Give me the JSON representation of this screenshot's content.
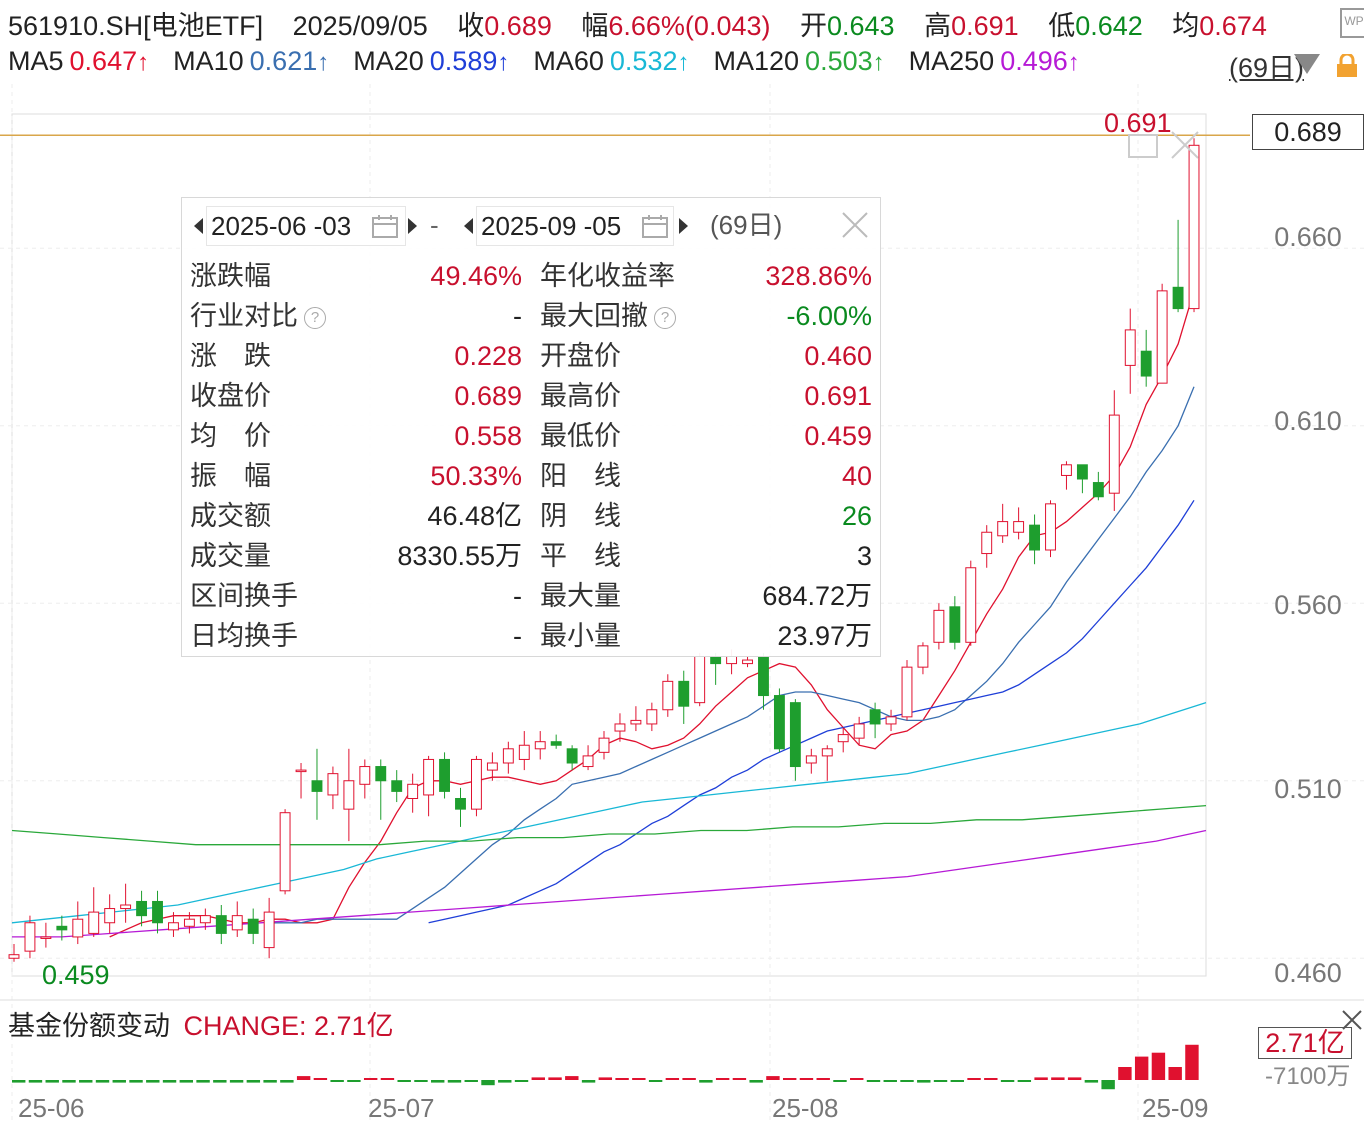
{
  "header": {
    "code": "561910.SH[电池ETF]",
    "date": "2025/09/05",
    "close_label": "收",
    "close": "0.689",
    "change_label": "幅",
    "change": "6.66%(0.043)",
    "open_label": "开",
    "open": "0.643",
    "high_label": "高",
    "high": "0.691",
    "low_label": "低",
    "low": "0.642",
    "avg_label": "均",
    "avg": "0.674"
  },
  "ma": [
    {
      "label": "MA5",
      "value": "0.647",
      "color": "#e0112f"
    },
    {
      "label": "MA10",
      "value": "0.621",
      "color": "#3a6fb0"
    },
    {
      "label": "MA20",
      "value": "0.589",
      "color": "#1f3fd8"
    },
    {
      "label": "MA60",
      "value": "0.532",
      "color": "#19b8d6"
    },
    {
      "label": "MA120",
      "value": "0.503",
      "color": "#2aa83a"
    },
    {
      "label": "MA250",
      "value": "0.496",
      "color": "#b61ad6"
    }
  ],
  "ma_arrow": "↑",
  "period_select": "(69日)",
  "y_axis": [
    "0.660",
    "0.610",
    "0.560",
    "0.510",
    "0.460"
  ],
  "current_price_tag": "0.689",
  "max_marker": "0.691",
  "min_marker": "0.459",
  "x_axis": [
    "25-06",
    "25-07",
    "25-08",
    "25-09"
  ],
  "stats_panel": {
    "start_date": "2025-06 -03",
    "separator": "-",
    "end_date": "2025-09 -05",
    "days": "(69日)",
    "rows": [
      {
        "l1": "涨跌幅",
        "v1": "49.46%",
        "c1": "red",
        "l2": "年化收益率",
        "v2": "328.86%",
        "c2": "red"
      },
      {
        "l1": "行业对比",
        "q1": true,
        "v1": "-",
        "c1": "dark",
        "l2": "最大回撤",
        "q2": true,
        "v2": "-6.00%",
        "c2": "green"
      },
      {
        "l1": "涨　跌",
        "v1": "0.228",
        "c1": "red",
        "l2": "开盘价",
        "v2": "0.460",
        "c2": "red"
      },
      {
        "l1": "收盘价",
        "v1": "0.689",
        "c1": "red",
        "l2": "最高价",
        "v2": "0.691",
        "c2": "red"
      },
      {
        "l1": "均　价",
        "v1": "0.558",
        "c1": "red",
        "l2": "最低价",
        "v2": "0.459",
        "c2": "red"
      },
      {
        "l1": "振　幅",
        "v1": "50.33%",
        "c1": "red",
        "l2": "阳　线",
        "v2": "40",
        "c2": "red"
      },
      {
        "l1": "成交额",
        "v1": "46.48亿",
        "c1": "dark",
        "l2": "阴　线",
        "v2": "26",
        "c2": "green"
      },
      {
        "l1": "成交量",
        "v1": "8330.55万",
        "c1": "dark",
        "l2": "平　线",
        "v2": "3",
        "c2": "dark"
      },
      {
        "l1": "区间换手",
        "v1": "-",
        "c1": "dark",
        "l2": "最大量",
        "v2": "684.72万",
        "c2": "dark"
      },
      {
        "l1": "日均换手",
        "v1": "-",
        "c1": "dark",
        "l2": "最小量",
        "v2": "23.97万",
        "c2": "dark"
      }
    ]
  },
  "sub_chart": {
    "title": "基金份额变动",
    "change_label": "CHANGE: 2.71亿",
    "value_tag": "2.71亿",
    "neg_tag": "-7100万"
  },
  "chart_data": {
    "type": "candlestick",
    "ylim": [
      0.455,
      0.695
    ],
    "candles": [
      [
        0.46,
        0.461,
        0.459,
        0.464
      ],
      [
        0.462,
        0.47,
        0.46,
        0.472
      ],
      [
        0.466,
        0.466,
        0.463,
        0.47
      ],
      [
        0.469,
        0.468,
        0.465,
        0.472
      ],
      [
        0.466,
        0.471,
        0.464,
        0.476
      ],
      [
        0.467,
        0.473,
        0.466,
        0.48
      ],
      [
        0.47,
        0.474,
        0.467,
        0.478
      ],
      [
        0.474,
        0.475,
        0.47,
        0.481
      ],
      [
        0.476,
        0.472,
        0.469,
        0.479
      ],
      [
        0.476,
        0.47,
        0.467,
        0.479
      ],
      [
        0.468,
        0.47,
        0.466,
        0.473
      ],
      [
        0.469,
        0.471,
        0.467,
        0.473
      ],
      [
        0.47,
        0.472,
        0.468,
        0.474
      ],
      [
        0.472,
        0.467,
        0.464,
        0.475
      ],
      [
        0.468,
        0.472,
        0.466,
        0.476
      ],
      [
        0.471,
        0.467,
        0.464,
        0.474
      ],
      [
        0.463,
        0.473,
        0.46,
        0.477
      ],
      [
        0.479,
        0.501,
        0.478,
        0.502
      ],
      [
        0.513,
        0.513,
        0.505,
        0.515
      ],
      [
        0.51,
        0.507,
        0.499,
        0.519
      ],
      [
        0.506,
        0.512,
        0.502,
        0.514
      ],
      [
        0.502,
        0.51,
        0.493,
        0.519
      ],
      [
        0.509,
        0.514,
        0.505,
        0.516
      ],
      [
        0.514,
        0.51,
        0.499,
        0.516
      ],
      [
        0.51,
        0.507,
        0.504,
        0.513
      ],
      [
        0.505,
        0.509,
        0.501,
        0.512
      ],
      [
        0.506,
        0.516,
        0.5,
        0.517
      ],
      [
        0.516,
        0.507,
        0.505,
        0.518
      ],
      [
        0.505,
        0.502,
        0.497,
        0.508
      ],
      [
        0.502,
        0.516,
        0.5,
        0.517
      ],
      [
        0.513,
        0.515,
        0.51,
        0.518
      ],
      [
        0.515,
        0.519,
        0.512,
        0.521
      ],
      [
        0.516,
        0.52,
        0.513,
        0.524
      ],
      [
        0.519,
        0.521,
        0.516,
        0.524
      ],
      [
        0.521,
        0.52,
        0.519,
        0.523
      ],
      [
        0.519,
        0.515,
        0.513,
        0.52
      ],
      [
        0.514,
        0.517,
        0.513,
        0.52
      ],
      [
        0.518,
        0.522,
        0.516,
        0.524
      ],
      [
        0.524,
        0.526,
        0.521,
        0.529
      ],
      [
        0.526,
        0.527,
        0.524,
        0.531
      ],
      [
        0.526,
        0.53,
        0.524,
        0.532
      ],
      [
        0.53,
        0.538,
        0.528,
        0.54
      ],
      [
        0.538,
        0.531,
        0.526,
        0.541
      ],
      [
        0.532,
        0.545,
        0.531,
        0.546
      ],
      [
        0.545,
        0.543,
        0.537,
        0.546
      ],
      [
        0.543,
        0.545,
        0.54,
        0.547
      ],
      [
        0.543,
        0.544,
        0.542,
        0.545
      ],
      [
        0.545,
        0.534,
        0.53,
        0.546
      ],
      [
        0.534,
        0.519,
        0.518,
        0.536
      ],
      [
        0.532,
        0.514,
        0.51,
        0.533
      ],
      [
        0.515,
        0.517,
        0.512,
        0.519
      ],
      [
        0.517,
        0.519,
        0.51,
        0.52
      ],
      [
        0.521,
        0.523,
        0.518,
        0.525
      ],
      [
        0.522,
        0.526,
        0.52,
        0.528
      ],
      [
        0.53,
        0.526,
        0.522,
        0.532
      ],
      [
        0.526,
        0.528,
        0.524,
        0.53
      ],
      [
        0.528,
        0.542,
        0.527,
        0.544
      ],
      [
        0.542,
        0.548,
        0.54,
        0.549
      ],
      [
        0.549,
        0.558,
        0.547,
        0.56
      ],
      [
        0.559,
        0.549,
        0.547,
        0.562
      ],
      [
        0.549,
        0.57,
        0.548,
        0.572
      ],
      [
        0.574,
        0.58,
        0.57,
        0.582
      ],
      [
        0.579,
        0.583,
        0.577,
        0.588
      ],
      [
        0.58,
        0.583,
        0.578,
        0.587
      ],
      [
        0.582,
        0.575,
        0.571,
        0.585
      ],
      [
        0.575,
        0.588,
        0.573,
        0.589
      ],
      [
        0.596,
        0.599,
        0.592,
        0.6
      ],
      [
        0.599,
        0.595,
        0.591,
        0.599
      ],
      [
        0.594,
        0.59,
        0.589,
        0.597
      ],
      [
        0.591,
        0.613,
        0.586,
        0.62
      ],
      [
        0.627,
        0.637,
        0.619,
        0.643
      ],
      [
        0.631,
        0.624,
        0.621,
        0.637
      ],
      [
        0.622,
        0.648,
        0.622,
        0.65
      ],
      [
        0.649,
        0.643,
        0.642,
        0.668
      ],
      [
        0.643,
        0.689,
        0.642,
        0.691
      ]
    ],
    "ma_lines": {
      "MA5": [
        0.466,
        0.468,
        0.47,
        0.471,
        0.472,
        0.472,
        0.472,
        0.471,
        0.47,
        0.47,
        0.471,
        0.471,
        0.47,
        0.47,
        0.471,
        0.48,
        0.487,
        0.493,
        0.501,
        0.508,
        0.51,
        0.51,
        0.509,
        0.51,
        0.511,
        0.511,
        0.51,
        0.509,
        0.51,
        0.513,
        0.516,
        0.52,
        0.522,
        0.521,
        0.519,
        0.52,
        0.522,
        0.526,
        0.531,
        0.535,
        0.539,
        0.541,
        0.543,
        0.542,
        0.537,
        0.53,
        0.525,
        0.52,
        0.519,
        0.523,
        0.524,
        0.527,
        0.534,
        0.541,
        0.549,
        0.557,
        0.564,
        0.573,
        0.579,
        0.58,
        0.583,
        0.587,
        0.591,
        0.596,
        0.604,
        0.616,
        0.624,
        0.633,
        0.648
      ],
      "MA10": [
        0.47,
        0.47,
        0.47,
        0.471,
        0.471,
        0.471,
        0.471,
        0.471,
        0.471,
        0.474,
        0.477,
        0.48,
        0.484,
        0.488,
        0.492,
        0.495,
        0.499,
        0.502,
        0.505,
        0.509,
        0.51,
        0.511,
        0.512,
        0.514,
        0.516,
        0.518,
        0.52,
        0.522,
        0.524,
        0.526,
        0.528,
        0.531,
        0.534,
        0.535,
        0.535,
        0.534,
        0.533,
        0.532,
        0.53,
        0.528,
        0.527,
        0.527,
        0.528,
        0.53,
        0.534,
        0.538,
        0.543,
        0.549,
        0.554,
        0.559,
        0.566,
        0.572,
        0.578,
        0.584,
        0.59,
        0.597,
        0.603,
        0.61,
        0.621
      ],
      "MA20": [
        0.47,
        0.471,
        0.472,
        0.473,
        0.474,
        0.475,
        0.477,
        0.479,
        0.481,
        0.484,
        0.487,
        0.49,
        0.492,
        0.495,
        0.498,
        0.5,
        0.503,
        0.506,
        0.508,
        0.511,
        0.513,
        0.516,
        0.518,
        0.52,
        0.522,
        0.524,
        0.525,
        0.526,
        0.527,
        0.528,
        0.529,
        0.53,
        0.531,
        0.532,
        0.533,
        0.534,
        0.535,
        0.537,
        0.54,
        0.543,
        0.546,
        0.55,
        0.555,
        0.56,
        0.565,
        0.57,
        0.576,
        0.582,
        0.589
      ],
      "MA60": [
        0.47,
        0.471,
        0.472,
        0.473,
        0.474,
        0.475,
        0.477,
        0.479,
        0.481,
        0.483,
        0.485,
        0.488,
        0.49,
        0.492,
        0.494,
        0.496,
        0.498,
        0.5,
        0.502,
        0.504,
        0.505,
        0.506,
        0.507,
        0.508,
        0.509,
        0.51,
        0.511,
        0.512,
        0.514,
        0.516,
        0.518,
        0.52,
        0.522,
        0.524,
        0.526,
        0.529,
        0.532
      ],
      "MA120": [
        0.496,
        0.495,
        0.494,
        0.493,
        0.492,
        0.492,
        0.492,
        0.492,
        0.492,
        0.493,
        0.493,
        0.494,
        0.494,
        0.495,
        0.495,
        0.496,
        0.496,
        0.497,
        0.497,
        0.498,
        0.498,
        0.499,
        0.499,
        0.5,
        0.501,
        0.502,
        0.503
      ],
      "MA250": [
        0.466,
        0.466,
        0.467,
        0.468,
        0.469,
        0.47,
        0.471,
        0.472,
        0.473,
        0.474,
        0.475,
        0.476,
        0.477,
        0.478,
        0.479,
        0.48,
        0.481,
        0.482,
        0.483,
        0.485,
        0.487,
        0.489,
        0.491,
        0.493,
        0.496
      ]
    },
    "share_change": [
      -0.2,
      -0.2,
      -0.2,
      -0.2,
      -0.2,
      -0.2,
      -0.2,
      -0.2,
      -0.2,
      -0.2,
      -0.2,
      -0.2,
      -0.2,
      -0.2,
      -0.2,
      -0.2,
      -0.2,
      0.3,
      0.1,
      -0.1,
      -0.1,
      0.1,
      0.1,
      -0.1,
      -0.1,
      -0.2,
      -0.2,
      -0.1,
      -0.4,
      -0.2,
      -0.1,
      0.2,
      0.2,
      0.3,
      -0.2,
      0.2,
      0.1,
      0.1,
      -0.1,
      0.1,
      0.1,
      -0.2,
      0.1,
      0.1,
      -0.2,
      0.3,
      0.1,
      0.1,
      0.1,
      -0.1,
      0.1,
      -0.1,
      -0.1,
      -0.1,
      -0.2,
      -0.1,
      -0.1,
      0.1,
      0.1,
      -0.1,
      -0.1,
      0.2,
      0.2,
      0.2,
      -0.2,
      -0.71,
      1.0,
      1.8,
      2.1,
      1.0,
      2.71
    ]
  }
}
